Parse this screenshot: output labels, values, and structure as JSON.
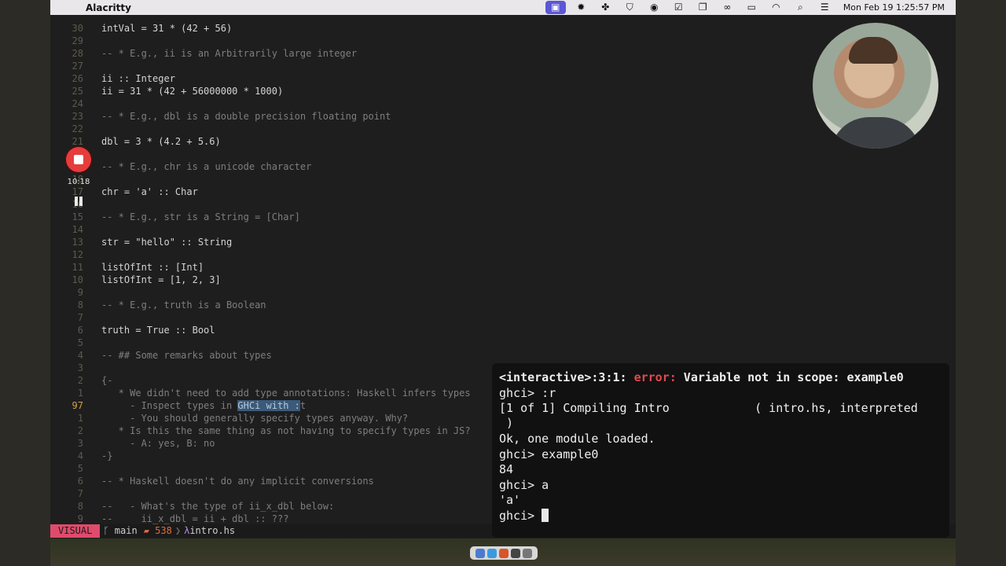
{
  "menubar": {
    "app_name": "Alacritty",
    "clock": "Mon Feb 19  1:25:57 PM",
    "icons": [
      "screen-record-icon",
      "gear-icon",
      "puzzle-icon",
      "shield-icon",
      "user-icon",
      "checkbox-icon",
      "window-icon",
      "glasses-icon",
      "battery-icon",
      "wifi-icon",
      "search-icon",
      "control-center-icon"
    ]
  },
  "recorder": {
    "elapsed": "10:18"
  },
  "editor": {
    "lines": [
      {
        "n": "30",
        "code": "intVal = 31 * (42 + 56)",
        "kind": "code"
      },
      {
        "n": "29",
        "code": "",
        "kind": "blank"
      },
      {
        "n": "28",
        "code": "-- * E.g., ii is an Arbitrarily large integer",
        "kind": "comment"
      },
      {
        "n": "27",
        "code": "",
        "kind": "blank"
      },
      {
        "n": "26",
        "code": "ii :: Integer",
        "kind": "code"
      },
      {
        "n": "25",
        "code": "ii = 31 * (42 + 56000000 * 1000)",
        "kind": "code"
      },
      {
        "n": "24",
        "code": "",
        "kind": "blank"
      },
      {
        "n": "23",
        "code": "-- * E.g., dbl is a double precision floating point",
        "kind": "comment"
      },
      {
        "n": "22",
        "code": "",
        "kind": "blank"
      },
      {
        "n": "21",
        "code": "dbl = 3 * (4.2 + 5.6)",
        "kind": "code"
      },
      {
        "n": "20",
        "code": "",
        "kind": "blank"
      },
      {
        "n": "19",
        "code": "-- * E.g., chr is a unicode character",
        "kind": "comment"
      },
      {
        "n": "18",
        "code": "",
        "kind": "blank"
      },
      {
        "n": "17",
        "code": "chr = 'a' :: Char",
        "kind": "code"
      },
      {
        "n": "16",
        "code": "",
        "kind": "blank"
      },
      {
        "n": "15",
        "code": "-- * E.g., str is a String = [Char]",
        "kind": "comment"
      },
      {
        "n": "14",
        "code": "",
        "kind": "blank"
      },
      {
        "n": "13",
        "code": "str = \"hello\" :: String",
        "kind": "code"
      },
      {
        "n": "12",
        "code": "",
        "kind": "blank"
      },
      {
        "n": "11",
        "code": "listOfInt :: [Int]",
        "kind": "code"
      },
      {
        "n": "10",
        "code": "listOfInt = [1, 2, 3]",
        "kind": "code"
      },
      {
        "n": "9",
        "code": "",
        "kind": "blank"
      },
      {
        "n": "8",
        "code": "-- * E.g., truth is a Boolean",
        "kind": "comment"
      },
      {
        "n": "7",
        "code": "",
        "kind": "blank"
      },
      {
        "n": "6",
        "code": "truth = True :: Bool",
        "kind": "code"
      },
      {
        "n": "5",
        "code": "",
        "kind": "blank"
      },
      {
        "n": "4",
        "code": "-- ## Some remarks about types",
        "kind": "comment"
      },
      {
        "n": "3",
        "code": "",
        "kind": "blank"
      },
      {
        "n": "2",
        "code": "{-",
        "kind": "comment"
      },
      {
        "n": "1",
        "code": "   * We didn't need to add type annotations: Haskell infers types",
        "kind": "comment"
      },
      {
        "n": "97",
        "code": "     - Inspect types in ",
        "sel": "GHCi with :",
        "after": "t",
        "kind": "selected"
      },
      {
        "n": "1",
        "code": "     - You should generally specify types anyway. Why?",
        "kind": "comment"
      },
      {
        "n": "2",
        "code": "   * Is this the same thing as not having to specify types in JS?",
        "kind": "comment"
      },
      {
        "n": "3",
        "code": "     - A: yes, B: no",
        "kind": "comment"
      },
      {
        "n": "4",
        "code": "-}",
        "kind": "comment"
      },
      {
        "n": "5",
        "code": "",
        "kind": "blank"
      },
      {
        "n": "6",
        "code": "-- * Haskell doesn't do any implicit conversions",
        "kind": "comment"
      },
      {
        "n": "7",
        "code": "",
        "kind": "blank"
      },
      {
        "n": "8",
        "code": "--   - What's the type of ii_x_dbl below:",
        "kind": "comment"
      },
      {
        "n": "9",
        "code": "--     ii_x_dbl = ii + dbl :: ???",
        "kind": "comment"
      }
    ]
  },
  "statusline": {
    "mode": "VISUAL",
    "branch": "main",
    "changes": "538",
    "file": "intro.hs"
  },
  "ghci": {
    "l1_prefix": "<interactive>:3:1: ",
    "l1_error": "error:",
    "l1_msg": " Variable not in scope: example0",
    "l2": "ghci> :r",
    "l3": "[1 of 1] Compiling Intro            ( intro.hs, interpreted",
    "l4": " )",
    "l5": "Ok, one module loaded.",
    "l6": "ghci> example0",
    "l7": "84",
    "l8": "ghci> a",
    "l9": "'a'",
    "l10": "ghci> "
  }
}
